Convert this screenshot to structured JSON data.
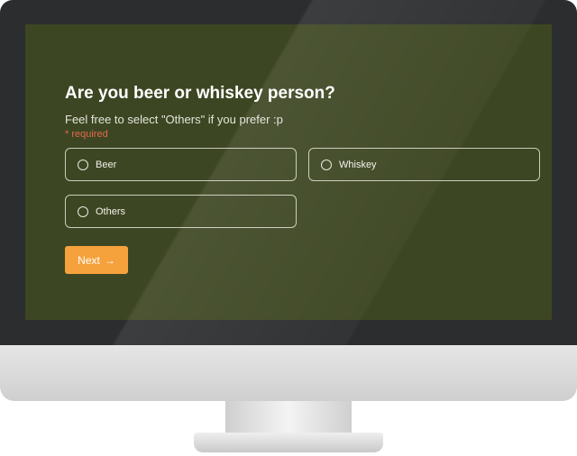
{
  "question": {
    "title": "Are you beer or whiskey person?",
    "subtitle": "Feel free to select \"Others\" if you prefer :p",
    "required": "* required"
  },
  "options": [
    {
      "label": "Beer",
      "selected": false
    },
    {
      "label": "Whiskey",
      "selected": false
    },
    {
      "label": "Others",
      "selected": false
    }
  ],
  "next_button": {
    "label": "Next",
    "icon": "arrow-right-icon",
    "arrow": "→"
  },
  "colors": {
    "screen_bg": "#3d4622",
    "accent": "#f5a23d",
    "required": "#e06a4e"
  }
}
